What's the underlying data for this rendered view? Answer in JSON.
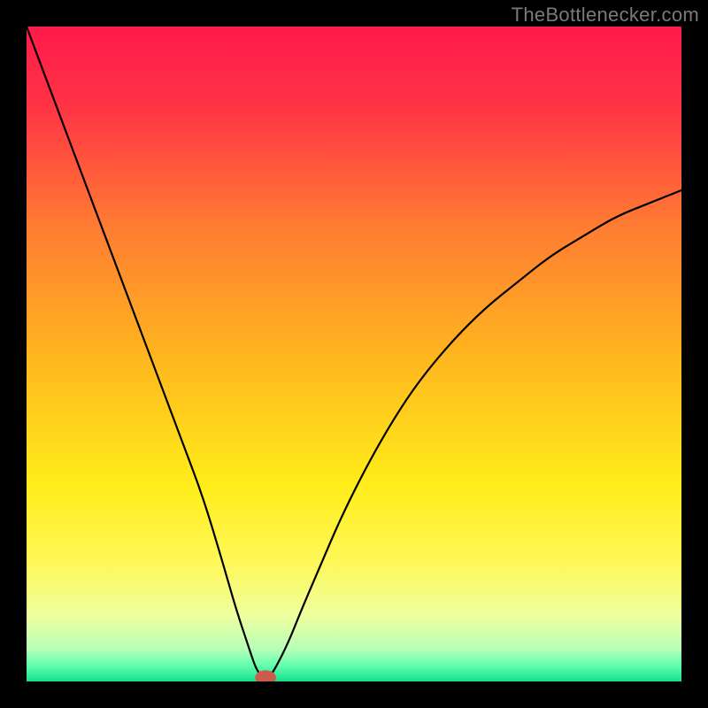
{
  "watermark": "TheBottlenecker.com",
  "chart_data": {
    "type": "line",
    "title": "",
    "xlabel": "",
    "ylabel": "",
    "xlim": [
      0,
      100
    ],
    "ylim": [
      0,
      100
    ],
    "background_gradient": {
      "stops": [
        {
          "offset": 0.0,
          "color": "#ff1a4b"
        },
        {
          "offset": 0.12,
          "color": "#ff3345"
        },
        {
          "offset": 0.3,
          "color": "#ff7a33"
        },
        {
          "offset": 0.5,
          "color": "#ffb51f"
        },
        {
          "offset": 0.7,
          "color": "#ffed1a"
        },
        {
          "offset": 0.82,
          "color": "#fff85a"
        },
        {
          "offset": 0.9,
          "color": "#eeff9e"
        },
        {
          "offset": 0.95,
          "color": "#b8ffb8"
        },
        {
          "offset": 0.975,
          "color": "#66ffb0"
        },
        {
          "offset": 1.0,
          "color": "#14e08a"
        }
      ]
    },
    "series": [
      {
        "name": "bottleneck-curve",
        "color": "#000000",
        "width": 2.2,
        "x": [
          0,
          3,
          6,
          9,
          12,
          15,
          18,
          21,
          24,
          27,
          30,
          32,
          34,
          35,
          36,
          37,
          38,
          40,
          42,
          45,
          48,
          52,
          56,
          60,
          65,
          70,
          75,
          80,
          85,
          90,
          95,
          100
        ],
        "y": [
          100,
          92,
          84,
          76,
          68,
          60,
          52,
          44,
          36,
          28,
          18,
          11,
          5,
          2,
          0.6,
          0.6,
          2,
          6,
          11,
          18,
          25,
          33,
          40,
          46,
          52,
          57,
          61,
          65,
          68,
          71,
          73,
          75
        ]
      }
    ],
    "marker": {
      "x": 36.5,
      "y": 0.6,
      "rx": 1.6,
      "ry": 1.1,
      "color": "#cc5b4b"
    }
  }
}
